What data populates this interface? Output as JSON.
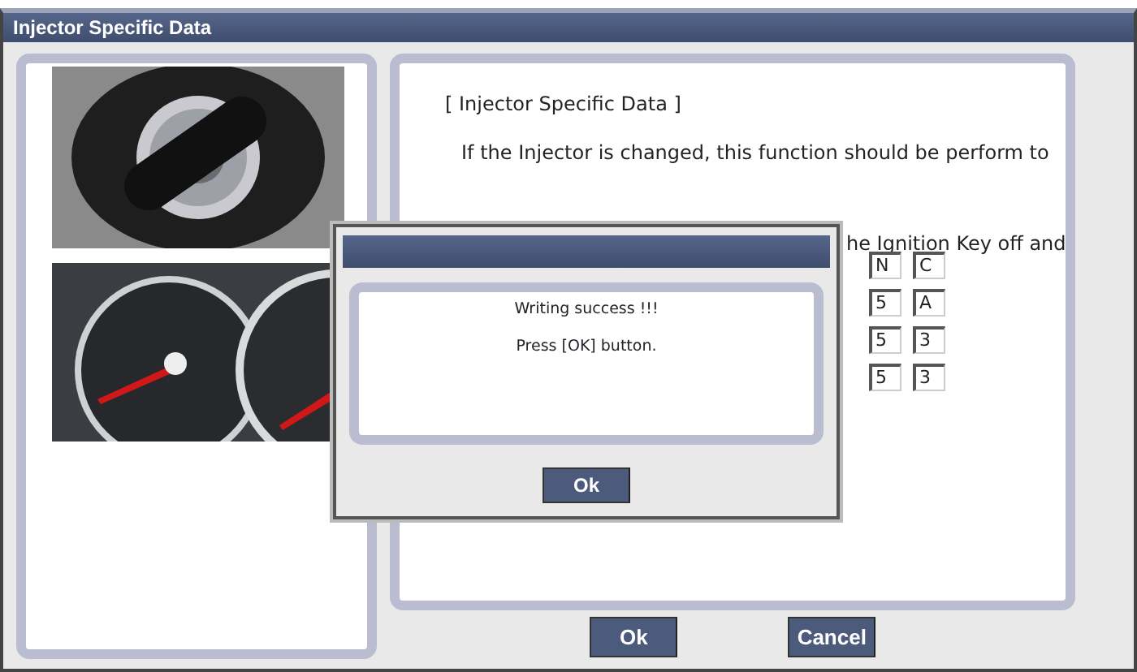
{
  "window": {
    "title": "Injector Specific Data"
  },
  "content": {
    "heading": "[ Injector Specific Data ]",
    "paragraph": "If the Injector is changed, this function should be perform to",
    "partial_line": "he Ignition Key off and",
    "code_rows": [
      [
        "N",
        "C"
      ],
      [
        "5",
        "A"
      ],
      [
        "5",
        "3"
      ],
      [
        "5",
        "3"
      ]
    ]
  },
  "buttons": [
    {
      "label": "Ok"
    },
    {
      "label": "Cancel"
    }
  ],
  "dialog": {
    "messages": [
      "Writing success !!!",
      "Press [OK] button."
    ],
    "button": "Ok"
  }
}
